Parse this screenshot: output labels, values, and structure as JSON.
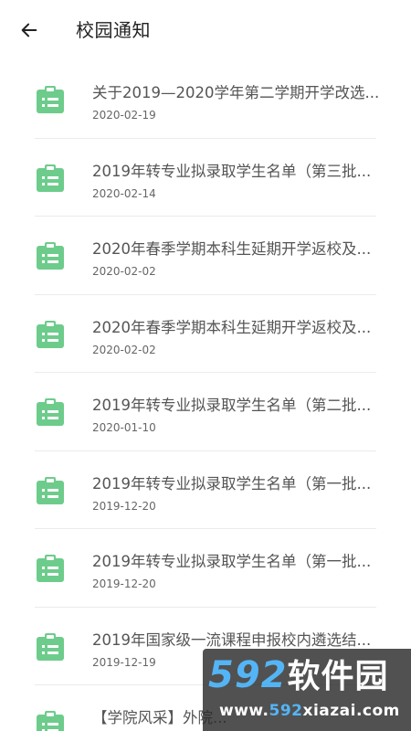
{
  "header": {
    "title": "校园通知",
    "back_icon": "arrow-left-icon"
  },
  "theme": {
    "icon_color": "#6dcc8b",
    "text_color": "#555555",
    "date_color": "#666666"
  },
  "notices": [
    {
      "title": "关于2019—2020学年第二学期开学改选...",
      "date": "2020-02-19"
    },
    {
      "title": "2019年转专业拟录取学生名单（第三批...",
      "date": "2020-02-14"
    },
    {
      "title": "2020年春季学期本科生延期开学返校及...",
      "date": "2020-02-02"
    },
    {
      "title": "2020年春季学期本科生延期开学返校及...",
      "date": "2020-02-02"
    },
    {
      "title": "2019年转专业拟录取学生名单（第二批...",
      "date": "2020-01-10"
    },
    {
      "title": "2019年转专业拟录取学生名单（第一批...",
      "date": "2019-12-20"
    },
    {
      "title": "2019年转专业拟录取学生名单（第一批...",
      "date": "2019-12-20"
    },
    {
      "title": "2019年国家级一流课程申报校内遴选结...",
      "date": "2019-12-19"
    },
    {
      "title": "【学院风采】外院...",
      "date": ""
    }
  ],
  "watermark": {
    "brand_num": "592",
    "brand_cn": "软件园",
    "url_prefix": "www.",
    "url_highlight": "592",
    "url_suffix": "xiazai.com"
  }
}
